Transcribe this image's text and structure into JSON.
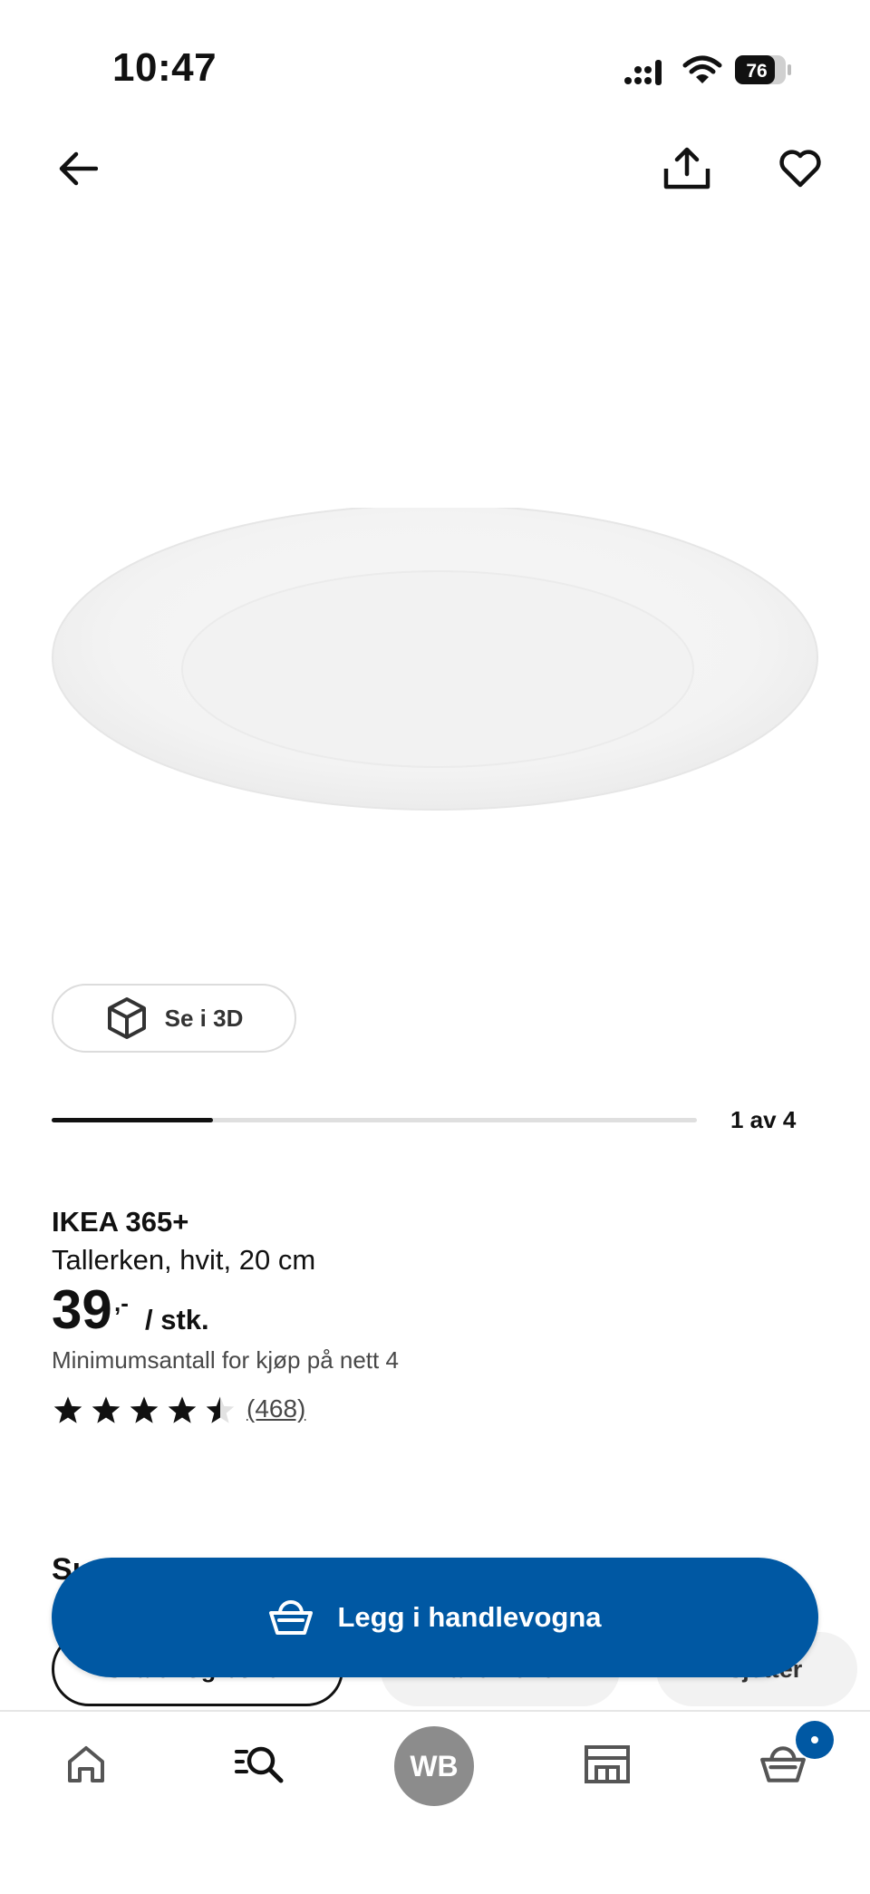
{
  "status_bar": {
    "time": "10:47",
    "battery": "76"
  },
  "top_bar": {
    "back_icon": "arrow-left-icon",
    "share_icon": "share-icon",
    "favorite_icon": "heart-icon"
  },
  "gallery": {
    "view_3d_label": "Se i 3D",
    "pager_label": "1 av 4",
    "current": 1,
    "total": 4
  },
  "product": {
    "brand": "IKEA 365+",
    "description": "Tallerken, hvit, 20 cm",
    "price": "39",
    "price_suffix": ",-",
    "unit": "/ stk.",
    "min_quantity": "Minimumsantall for kjøp på nett 4",
    "rating": 4.5,
    "rating_max": 5,
    "reviews": "(468)"
  },
  "similar": {
    "heading": "Sı",
    "chips": [
      "Skåler og boller",
      "Tallerkener",
      "Asjetter"
    ]
  },
  "cta": {
    "label": "Legg i handlevogna",
    "icon": "basket-icon"
  },
  "bottom_nav": {
    "avatar_initials": "WB",
    "items": [
      "home-icon",
      "search-icon",
      "avatar",
      "store-icon",
      "cart-icon"
    ]
  },
  "colors": {
    "primary": "#0058a3",
    "text": "#111111",
    "muted": "#484848"
  }
}
